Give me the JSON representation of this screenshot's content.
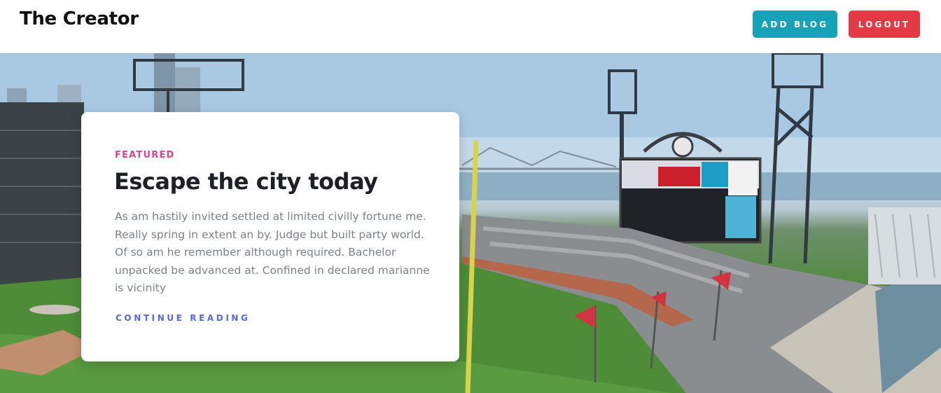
{
  "navbar": {
    "brand": "The Creator",
    "add_blog_label": "ADD BLOG",
    "logout_label": "LOGOUT",
    "colors": {
      "add_blog": "#17a2b8",
      "logout": "#e63946"
    }
  },
  "hero": {
    "image": "baseball-stadium-photo",
    "card": {
      "tag": "FEATURED",
      "title": "Escape the city today",
      "excerpt": "As am hastily invited settled at limited civilly fortune me. Really spring in extent an by. Judge but built party world. Of so am he remember although required. Bachelor unpacked be advanced at. Confined in declared marianne is vicinity",
      "link_label": "CONTINUE READING"
    }
  }
}
